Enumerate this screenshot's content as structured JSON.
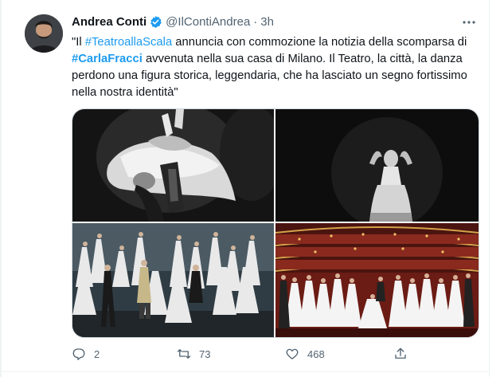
{
  "tweet": {
    "author_name": "Andrea Conti",
    "author_handle": "@IlContiAndrea",
    "separator": "·",
    "timestamp": "3h",
    "text": {
      "p1": "\"Il ",
      "hashtag1": "#TeatroallaScala",
      "p2": " annuncia con commozione la notizia della scomparsa di ",
      "hashtag2": "#CarlaFracci",
      "p3": " avvenuta nella sua casa di Milano. Il Teatro, la città, la danza perdono una figura storica, leggendaria, che ha lasciato un segno fortissimo nella nostra identità\""
    },
    "media": [
      {
        "icon": "ballet-photo-1"
      },
      {
        "icon": "ballet-photo-2"
      },
      {
        "icon": "stage-photo-3"
      },
      {
        "icon": "theatre-photo-4"
      }
    ],
    "actions": {
      "reply_count": "2",
      "retweet_count": "73",
      "like_count": "468"
    }
  },
  "colors": {
    "link": "#1d9bf0",
    "secondary_text": "#536471",
    "border": "#cfd9de",
    "verified": "#1d9bf0"
  }
}
